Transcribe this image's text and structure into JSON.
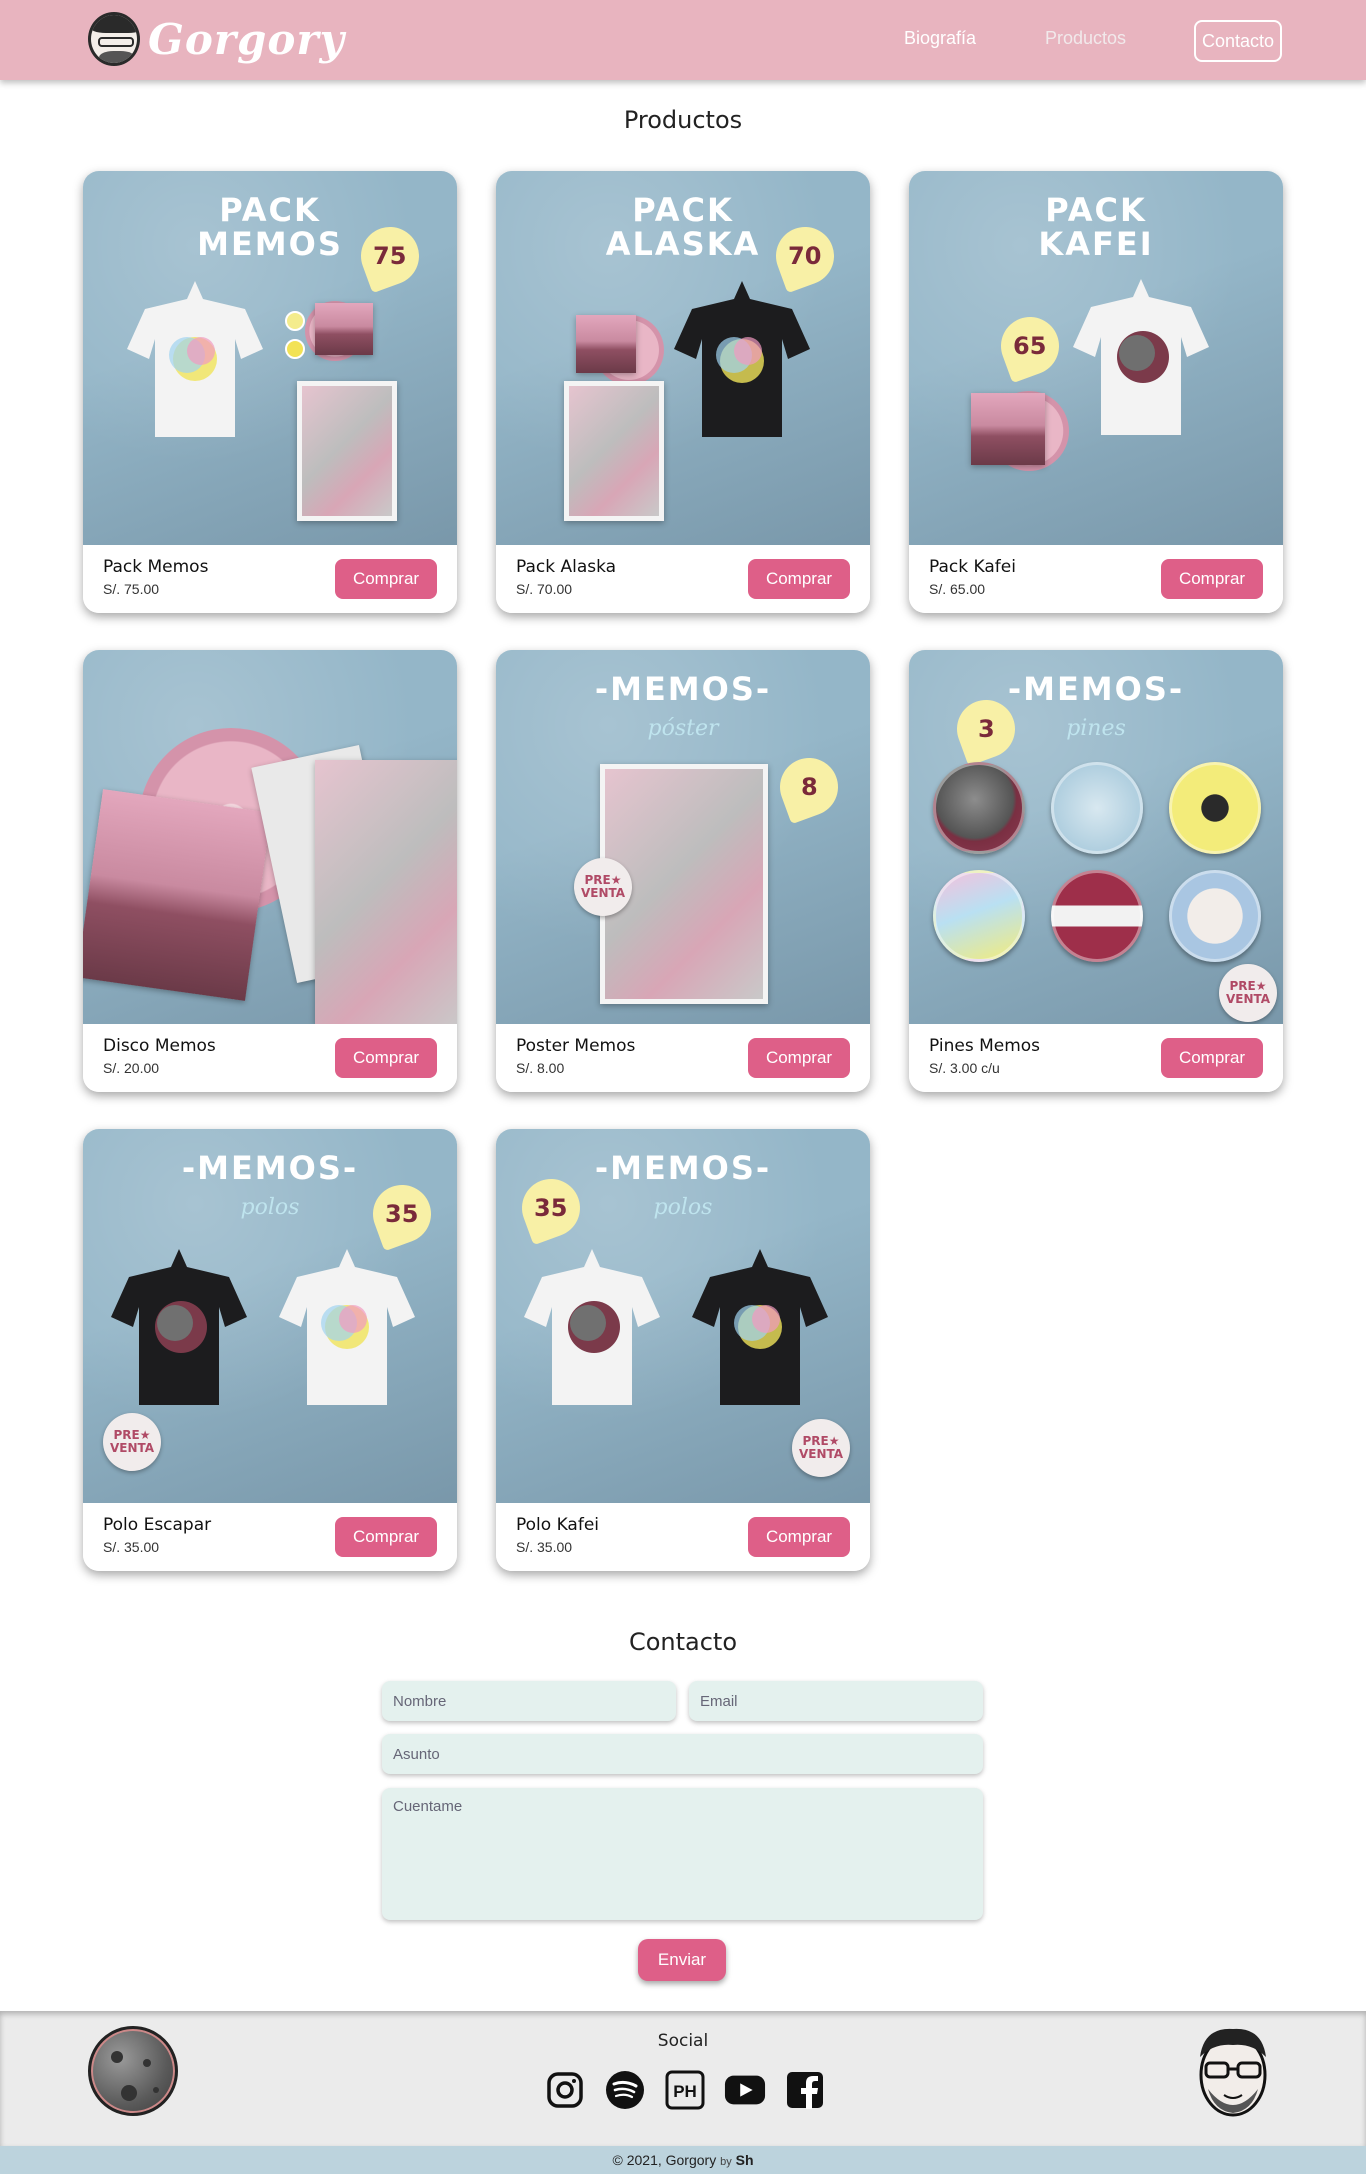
{
  "nav": {
    "brand": "Gorgory",
    "links": [
      "Biografía",
      "Productos",
      "Contacto"
    ]
  },
  "products_section": {
    "title": "Productos",
    "buy_label": "Comprar",
    "items": [
      {
        "name": "Pack Memos",
        "price": "S/. 75.00",
        "image_title": "PACK\nMEMOS",
        "tag": "75"
      },
      {
        "name": "Pack Alaska",
        "price": "S/. 70.00",
        "image_title": "PACK\nALASKA",
        "tag": "70"
      },
      {
        "name": "Pack Kafei",
        "price": "S/. 65.00",
        "image_title": "PACK\nKAFEI",
        "tag": "65"
      },
      {
        "name": "Disco Memos",
        "price": "S/. 20.00",
        "image_title": "",
        "tag": ""
      },
      {
        "name": "Poster Memos",
        "price": "S/. 8.00",
        "image_title": "-MEMOS-",
        "image_sub": "póster",
        "tag": "8",
        "badge": "PRE★ VENTA"
      },
      {
        "name": "Pines Memos",
        "price": "S/. 3.00 c/u",
        "image_title": "-MEMOS-",
        "image_sub": "pines",
        "tag": "3",
        "badge": "PRE★ VENTA"
      },
      {
        "name": "Polo Escapar",
        "price": "S/. 35.00",
        "image_title": "-MEMOS-",
        "image_sub": "polos",
        "tag": "35",
        "badge": "PRE★ VENTA"
      },
      {
        "name": "Polo Kafei",
        "price": "S/. 35.00",
        "image_title": "-MEMOS-",
        "image_sub": "polos",
        "tag": "35",
        "badge": "PRE★ VENTA"
      }
    ]
  },
  "contact": {
    "title": "Contacto",
    "name_placeholder": "Nombre",
    "email_placeholder": "Email",
    "subject_placeholder": "Asunto",
    "message_placeholder": "Cuentame",
    "send_label": "Enviar"
  },
  "footer": {
    "social_title": "Social",
    "social_icons": [
      "instagram-icon",
      "spotify-icon",
      "producthunt-icon",
      "youtube-icon",
      "facebook-icon"
    ],
    "copyright": "© 2021, Gorgory",
    "by": "by",
    "author": "Sh"
  },
  "colors": {
    "nav_bg": "#e8b4bf",
    "accent": "#de5f88",
    "field_bg": "#e4f1ee",
    "footer_bg": "#ebebeb",
    "bottom_bar": "#bcd3dd",
    "card_bg": "#94b6c8"
  }
}
